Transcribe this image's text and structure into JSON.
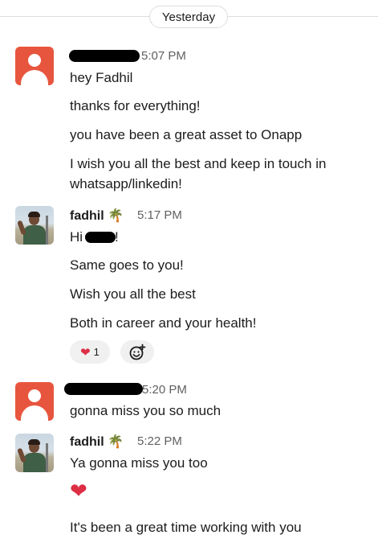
{
  "divider": {
    "label": "Yesterday"
  },
  "messages": [
    {
      "sender": "",
      "time": "5:07 PM",
      "lines": [
        "hey Fadhil",
        "thanks for everything!",
        "you have been a great asset to Onapp",
        "I wish you all the best and keep in touch in",
        "whatsapp/linkedin!"
      ]
    },
    {
      "sender": "fadhil",
      "status_emoji": "🌴",
      "time": "5:17 PM",
      "lines": [
        "Hi",
        "!",
        "Same goes to you!",
        "Wish you all the best",
        "Both in career and your health!"
      ],
      "reactions": [
        {
          "emoji": "❤",
          "count": "1"
        }
      ]
    },
    {
      "sender": "",
      "time": "5:20 PM",
      "lines": [
        "gonna miss you so much"
      ]
    },
    {
      "sender": "fadhil",
      "status_emoji": "🌴",
      "time": "5:22 PM",
      "lines": [
        "Ya gonna miss you too",
        "❤",
        "It's been a great time working with you"
      ]
    }
  ],
  "icons": {
    "add_reaction": "add-reaction-icon",
    "heart": "heart-icon",
    "status": "palm-tree-icon"
  },
  "colors": {
    "default_avatar": "#e8553e",
    "heart": "#dd2e44",
    "timestamp": "#616061"
  }
}
